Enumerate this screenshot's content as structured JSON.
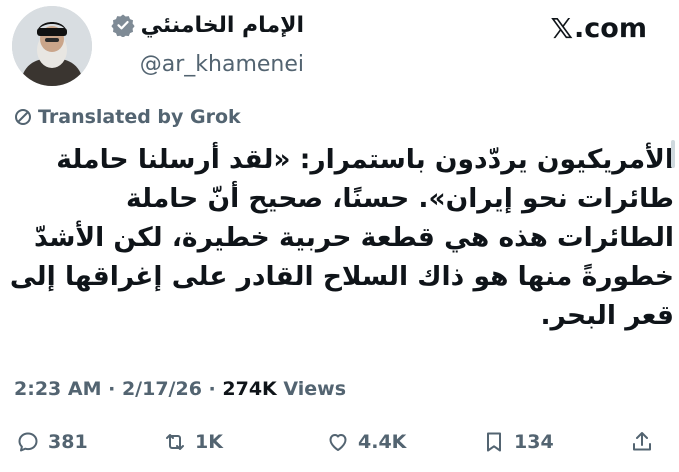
{
  "header": {
    "display_name": "الإمام الخامنئي",
    "handle": "@ar_khamenei",
    "site": "com",
    "site_logo": "𝕏"
  },
  "translation": {
    "label": "Translated by Grok"
  },
  "tweet": {
    "lines": [
      "الأمريكيون يردّدون باستمرار: «لقد أرسلنا حاملة",
      "طائرات نحو إيران». حسنًا، صحيح أنّ حاملة",
      "الطائرات هذه هي قطعة حربية خطيرة، لكن الأشدّ",
      "خطورةً منها هو ذاك السلاح القادر على إغراقها إلى",
      "قعر البحر."
    ]
  },
  "meta": {
    "time": "2:23 AM",
    "date": "2/17/26",
    "separator": " · ",
    "views_count": "274K",
    "views_label": " Views"
  },
  "actions": {
    "replies": "381",
    "reposts": "1K",
    "likes": "4.4K",
    "bookmarks": "134"
  },
  "colors": {
    "verified": "#7f8b96",
    "muted": "#536471",
    "text": "#0f1419"
  }
}
